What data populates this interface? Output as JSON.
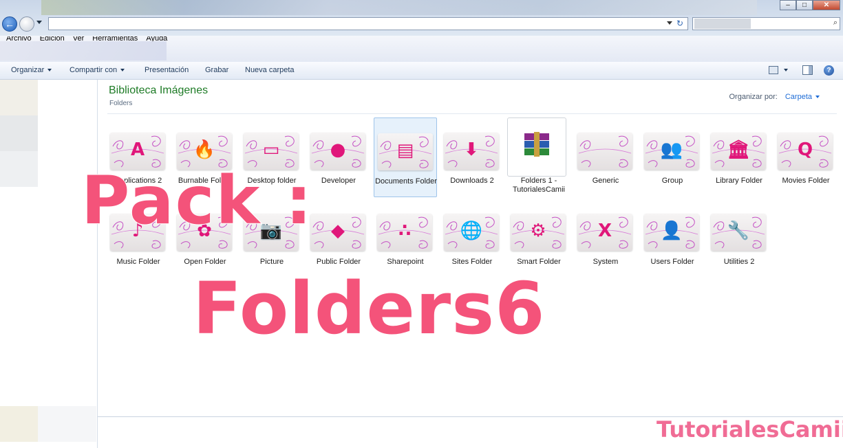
{
  "window": {
    "controls": [
      "–",
      "□",
      "✕"
    ]
  },
  "address": {
    "value": "",
    "search_placeholder": ""
  },
  "menu": [
    "Archivo",
    "Edición",
    "Ver",
    "Herramientas",
    "Ayuda"
  ],
  "toolbar": {
    "organize": "Organizar",
    "share": "Compartir con",
    "slideshow": "Presentación",
    "burn": "Grabar",
    "new_folder": "Nueva carpeta"
  },
  "library": {
    "title": "Biblioteca Imágenes",
    "subtitle": "Folders",
    "arrange_label": "Organizar por:",
    "arrange_value": "Carpeta"
  },
  "items": [
    {
      "label": "Applications 2",
      "icon": "app-store-icon",
      "glyph": "A"
    },
    {
      "label": "Burnable Folder",
      "icon": "flame-icon",
      "glyph": "🔥"
    },
    {
      "label": "Desktop folder",
      "icon": "monitor-icon",
      "glyph": "▭"
    },
    {
      "label": "Developer",
      "icon": "apple-icon",
      "glyph": "●"
    },
    {
      "label": "Documents Folder",
      "icon": "documents-icon",
      "glyph": "▤"
    },
    {
      "label": "Downloads 2",
      "icon": "download-arrow-icon",
      "glyph": "⬇"
    },
    {
      "label": "Folders 1 -TutorialesCamii",
      "icon": "winrar-archive-icon",
      "glyph": "▦"
    },
    {
      "label": "Generic",
      "icon": "flower-icon",
      "glyph": ""
    },
    {
      "label": "Group",
      "icon": "group-people-icon",
      "glyph": "👥"
    },
    {
      "label": "Library Folder",
      "icon": "library-columns-icon",
      "glyph": "🏛"
    },
    {
      "label": "Movies Folder",
      "icon": "quicktime-icon",
      "glyph": "Q"
    },
    {
      "label": "Music Folder",
      "icon": "music-note-icon",
      "glyph": "♪"
    },
    {
      "label": "Open Folder",
      "icon": "flower-icon",
      "glyph": "✿"
    },
    {
      "label": "Picture",
      "icon": "camera-icon",
      "glyph": "📷"
    },
    {
      "label": "Public Folder",
      "icon": "pedestrian-sign-icon",
      "glyph": "◆"
    },
    {
      "label": "Sharepoint",
      "icon": "share-dots-icon",
      "glyph": "∴"
    },
    {
      "label": "Sites Folder",
      "icon": "globe-icon",
      "glyph": "🌐"
    },
    {
      "label": "Smart Folder",
      "icon": "gear-icon",
      "glyph": "⚙"
    },
    {
      "label": "System",
      "icon": "x-icon",
      "glyph": "X"
    },
    {
      "label": "Users Folder",
      "icon": "user-icon",
      "glyph": "👤"
    },
    {
      "label": "Utilities 2",
      "icon": "wrench-icon",
      "glyph": "🔧"
    }
  ],
  "overlay": {
    "line1": "Pack :",
    "line2": "Folders6",
    "brand": "TutorialesCamii"
  },
  "colors": {
    "accent_pink": "#e0177a",
    "overlay_pink": "#f4537a",
    "library_title_green": "#1e7b26",
    "link_blue": "#1e6cd6"
  }
}
